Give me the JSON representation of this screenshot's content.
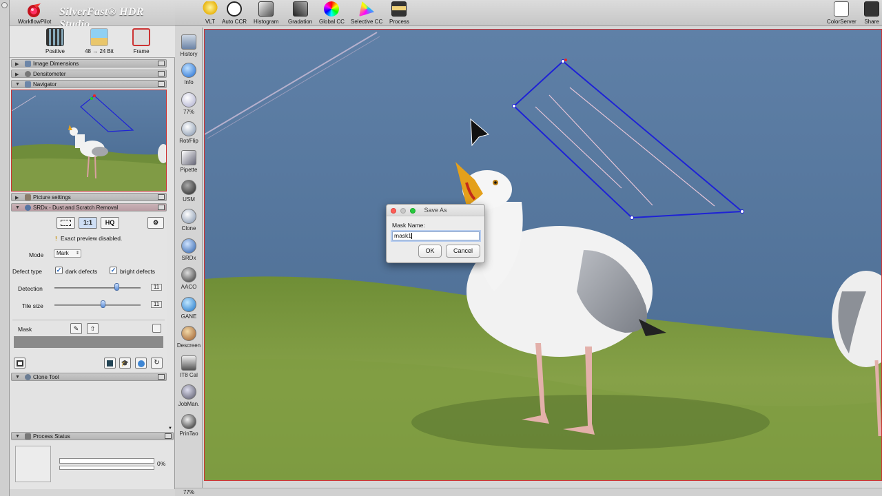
{
  "app": {
    "brand": "SilverFast® HDR Studio",
    "workflow_label": "WorkflowPilot"
  },
  "modes": [
    {
      "label": "Positive"
    },
    {
      "label": "48 → 24 Bit"
    },
    {
      "label": "Frame"
    }
  ],
  "sections": {
    "image_dimensions": "Image Dimensions",
    "densitometer": "Densitometer",
    "navigator": "Navigator",
    "picture_settings": "Picture settings",
    "srdx": "SRDx - Dust and Scratch Removal",
    "clone_tool": "Clone Tool",
    "process_status": "Process Status"
  },
  "srdx": {
    "btn_hq": "HQ",
    "btn_11": "1:1",
    "warning": "Exact preview disabled.",
    "mode_label": "Mode",
    "mode_value": "Mark",
    "defect_label": "Defect type",
    "dark_defects": "dark defects",
    "bright_defects": "bright defects",
    "dark_checked": true,
    "bright_checked": true,
    "detection_label": "Detection",
    "detection_value": "11",
    "detection_level": 0.72,
    "tile_label": "Tile size",
    "tile_value": "11",
    "tile_level": 0.56,
    "mask_label": "Mask"
  },
  "process": {
    "percent": "0%",
    "progress": 0
  },
  "tools": [
    {
      "label": "History",
      "icon": "history-icon"
    },
    {
      "label": "Info",
      "icon": "info-icon"
    },
    {
      "label": "77%",
      "icon": "zoom-icon"
    },
    {
      "label": "Rot/Flip",
      "icon": "rotate-icon"
    },
    {
      "label": "Pipette",
      "icon": "pipette-icon"
    },
    {
      "label": "USM",
      "icon": "usm-icon"
    },
    {
      "label": "Clone",
      "icon": "clone-icon"
    },
    {
      "label": "SRDx",
      "icon": "srdx-icon"
    },
    {
      "label": "AACO",
      "icon": "aaco-icon"
    },
    {
      "label": "GANE",
      "icon": "gane-icon"
    },
    {
      "label": "Descreen",
      "icon": "descreen-icon"
    },
    {
      "label": "IT8 Cal",
      "icon": "it8-icon"
    },
    {
      "label": "JobMan.",
      "icon": "jobmanager-icon"
    },
    {
      "label": "PrinTao",
      "icon": "printao-icon"
    }
  ],
  "toolbar": [
    {
      "label": "VLT",
      "icon": "vlt-icon"
    },
    {
      "label": "Auto CCR",
      "icon": "auto-ccr-icon"
    },
    {
      "label": "Histogram",
      "icon": "histogram-icon"
    },
    {
      "label": "Gradation",
      "icon": "gradation-icon"
    },
    {
      "label": "Global CC",
      "icon": "global-cc-icon"
    },
    {
      "label": "Selective CC",
      "icon": "selective-cc-icon"
    },
    {
      "label": "Process",
      "icon": "process-icon"
    },
    {
      "label": "ColorServer",
      "icon": "colorserver-icon"
    },
    {
      "label": "Share",
      "icon": "share-icon"
    }
  ],
  "statusbar": {
    "zoom": "77%"
  },
  "dialog": {
    "title": "Save As",
    "field_label": "Mask Name:",
    "field_value": "mask1",
    "ok_label": "OK",
    "cancel_label": "Cancel"
  },
  "colors": {
    "accent": "#1d5fb8",
    "selection_line": "#1e22d6",
    "frame_red": "#cc3333"
  }
}
